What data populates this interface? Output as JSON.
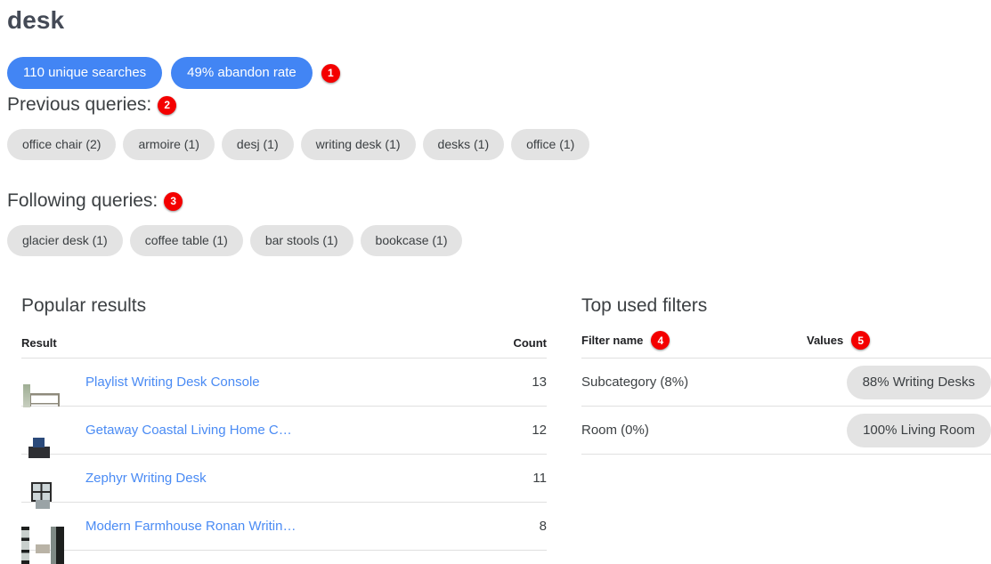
{
  "query": {
    "term": "desk"
  },
  "stats": [
    {
      "label": "110 unique searches"
    },
    {
      "label": "49% abandon rate"
    }
  ],
  "badges": {
    "b1": "1",
    "b2": "2",
    "b3": "3",
    "b4": "4",
    "b5": "5"
  },
  "previous_queries": {
    "heading": "Previous queries:",
    "chips": [
      {
        "label": "office chair (2)"
      },
      {
        "label": "armoire (1)"
      },
      {
        "label": "desj (1)"
      },
      {
        "label": "writing desk (1)"
      },
      {
        "label": "desks (1)"
      },
      {
        "label": "office (1)"
      }
    ]
  },
  "following_queries": {
    "heading": "Following queries:",
    "chips": [
      {
        "label": "glacier desk (1)"
      },
      {
        "label": "coffee table (1)"
      },
      {
        "label": "bar stools (1)"
      },
      {
        "label": "bookcase (1)"
      }
    ]
  },
  "popular_results": {
    "title": "Popular results",
    "columns": {
      "result": "Result",
      "count": "Count"
    },
    "rows": [
      {
        "name": "Playlist Writing Desk Console",
        "count": "13",
        "thumb": "writing-desk-console-thumbnail"
      },
      {
        "name": "Getaway Coastal Living Home C…",
        "count": "12",
        "thumb": "coastal-living-console-thumbnail"
      },
      {
        "name": "Zephyr Writing Desk",
        "count": "11",
        "thumb": "zephyr-writing-desk-thumbnail"
      },
      {
        "name": "Modern Farmhouse Ronan Writin…",
        "count": "8",
        "thumb": "modern-farmhouse-desk-thumbnail"
      }
    ]
  },
  "top_used_filters": {
    "title": "Top used filters",
    "columns": {
      "filter_name": "Filter name",
      "values": "Values"
    },
    "rows": [
      {
        "name": "Subcategory (8%)",
        "value": "88% Writing Desks"
      },
      {
        "name": "Room (0%)",
        "value": "100% Living Room"
      }
    ]
  },
  "colors": {
    "accent_blue": "#4285f4",
    "link_blue": "#4a8bf4",
    "badge_red": "#f40000",
    "chip_gray": "#e3e3e3",
    "text_dark": "#3c4043"
  }
}
